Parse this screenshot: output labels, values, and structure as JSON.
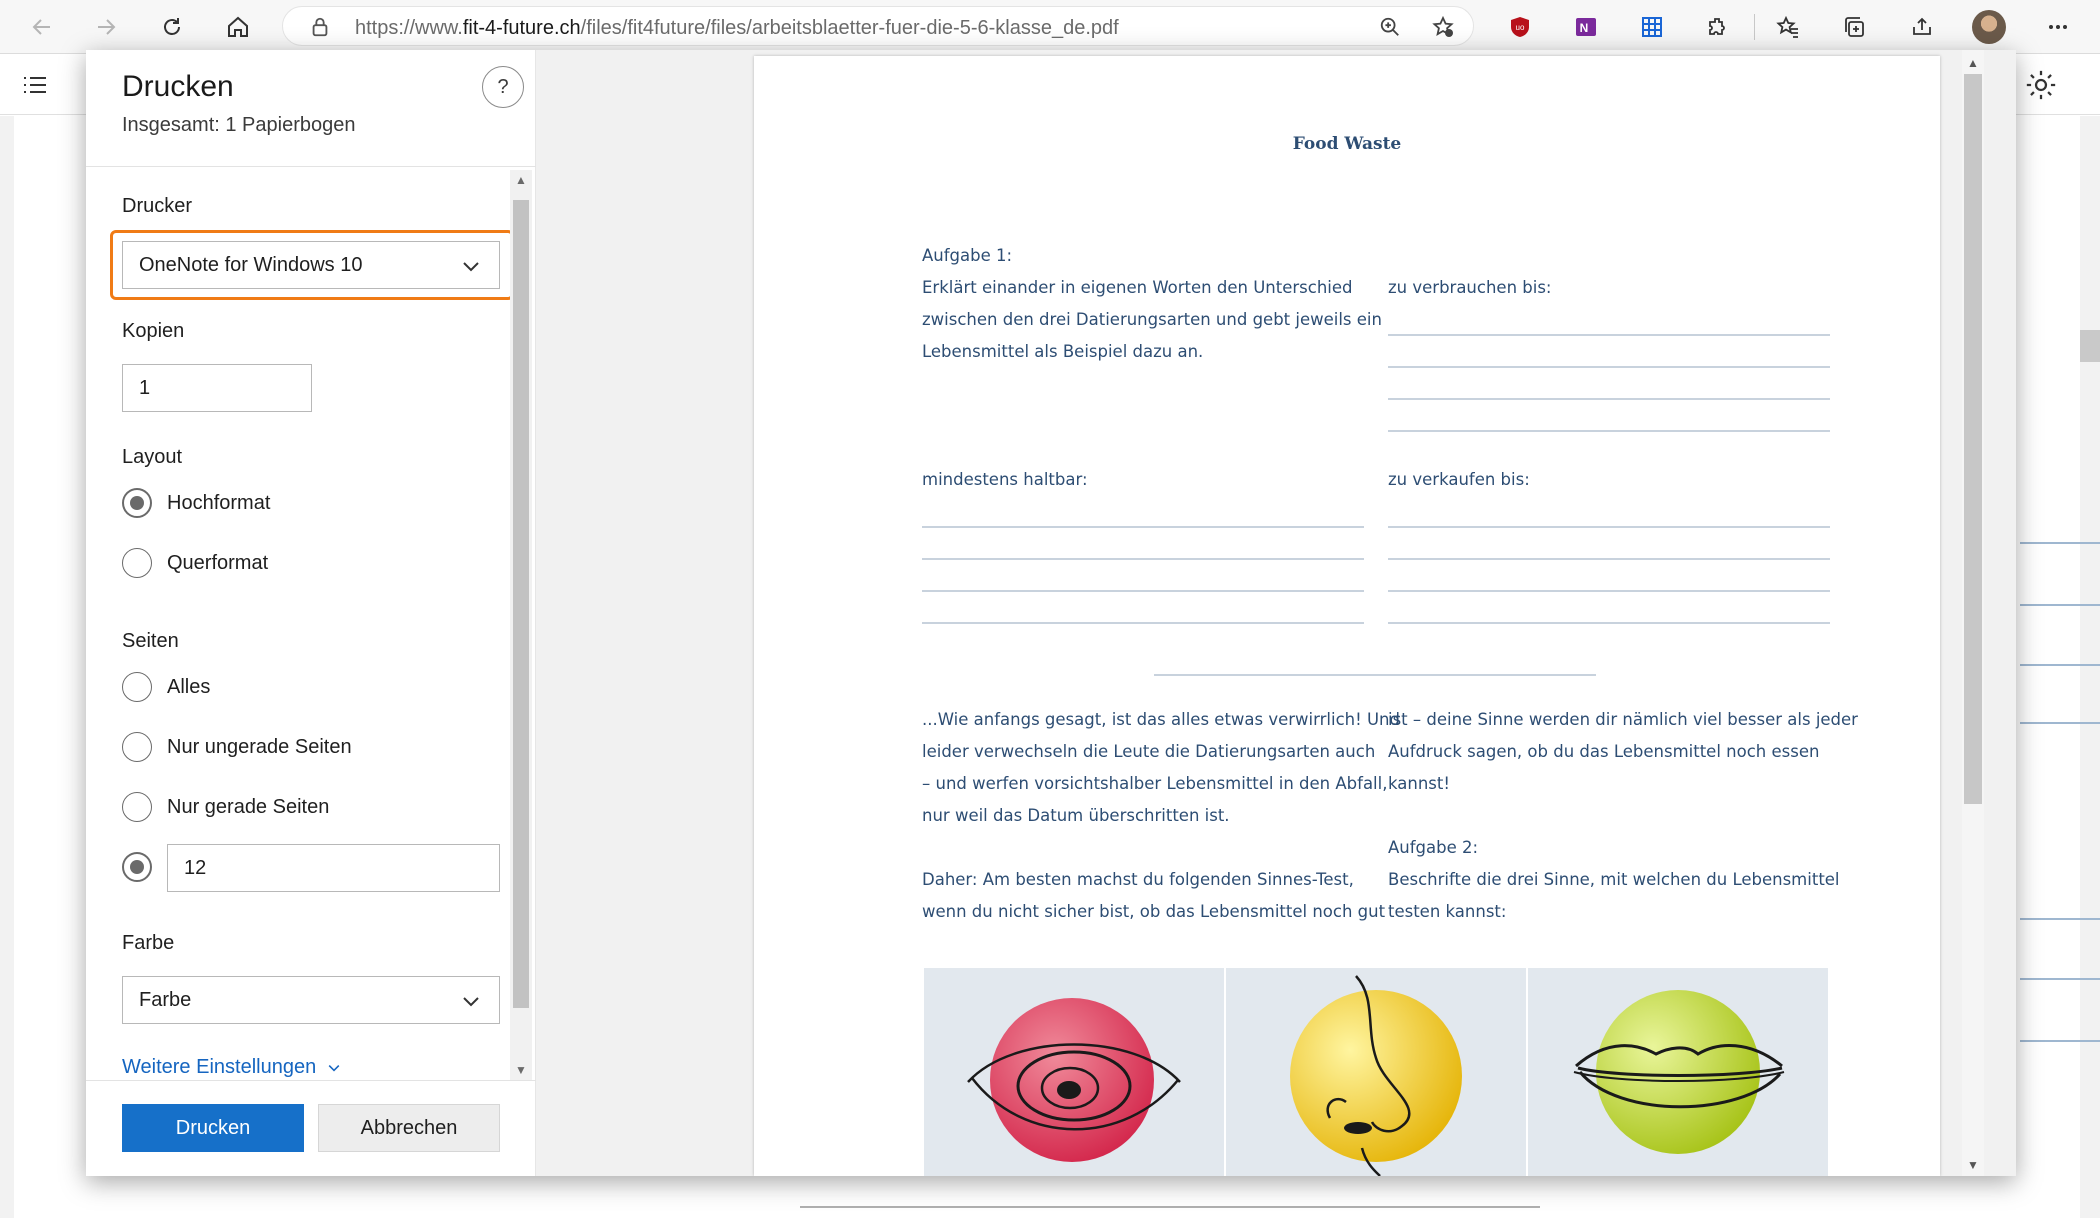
{
  "browser": {
    "url_prefix": "https://www.",
    "url_domain": "fit-4-future.ch",
    "url_path": "/files/fit4future/files/arbeitsblaetter-fuer-die-5-6-klasse_de.pdf",
    "icons": [
      "back-icon",
      "forward-icon",
      "refresh-icon",
      "home-icon",
      "lock-icon",
      "zoom-icon",
      "add-favorite-icon",
      "ublock-icon",
      "onenote-icon",
      "grid-icon",
      "extensions-icon",
      "favorites-icon",
      "collections-icon",
      "share-icon",
      "more-icon"
    ]
  },
  "dialog": {
    "title": "Drucken",
    "subtitle": "Insgesamt: 1 Papierbogen",
    "help": "?",
    "printer_label": "Drucker",
    "printer_value": "OneNote for Windows 10",
    "copies_label": "Kopien",
    "copies_value": "1",
    "layout_label": "Layout",
    "layout_options": [
      "Hochformat",
      "Querformat"
    ],
    "layout_selected": "Hochformat",
    "pages_label": "Seiten",
    "pages_options": [
      "Alles",
      "Nur ungerade Seiten",
      "Nur gerade Seiten"
    ],
    "pages_custom_value": "12",
    "color_label": "Farbe",
    "color_value": "Farbe",
    "more_settings": "Weitere Einstellungen",
    "print_button": "Drucken",
    "cancel_button": "Abbrechen"
  },
  "preview": {
    "title": "Food Waste",
    "task1_label": "Aufgabe 1:",
    "task1_text": "Erklärt einander in eigenen Worten den Unterschied\nzwischen den drei Datierungsarten und gebt jeweils ein\nLebensmittel als Beispiel dazu an.",
    "field_use": "zu verbrauchen bis:",
    "field_min": "mindestens haltbar:",
    "field_sell": "zu verkaufen bis:",
    "para_left": "...Wie anfangs gesagt, ist das alles etwas verwirrlich! Und\nleider verwechseln die Leute die Datierungsarten auch\n– und werfen vorsichtshalber Lebensmittel in den Abfall,\nnur weil das Datum überschritten ist.\n\nDaher: Am besten machst du folgenden Sinnes-Test,\nwenn du nicht sicher bist, ob das Lebensmittel noch gut",
    "para_right": "ist – deine Sinne werden dir nämlich viel besser als jeder\nAufdruck sagen, ob du das Lebensmittel noch essen\nkannst!",
    "task2_label": "Aufgabe 2:",
    "task2_text": "Beschrifte die drei Sinne, mit welchen du Lebensmittel\ntesten kannst:",
    "senses": [
      "eye-illustration",
      "nose-illustration",
      "mouth-illustration"
    ]
  },
  "colors": {
    "accent": "#1670c9",
    "highlight": "#f07b15",
    "page_text": "#2d4d73",
    "task_orange": "#ee8a25"
  }
}
